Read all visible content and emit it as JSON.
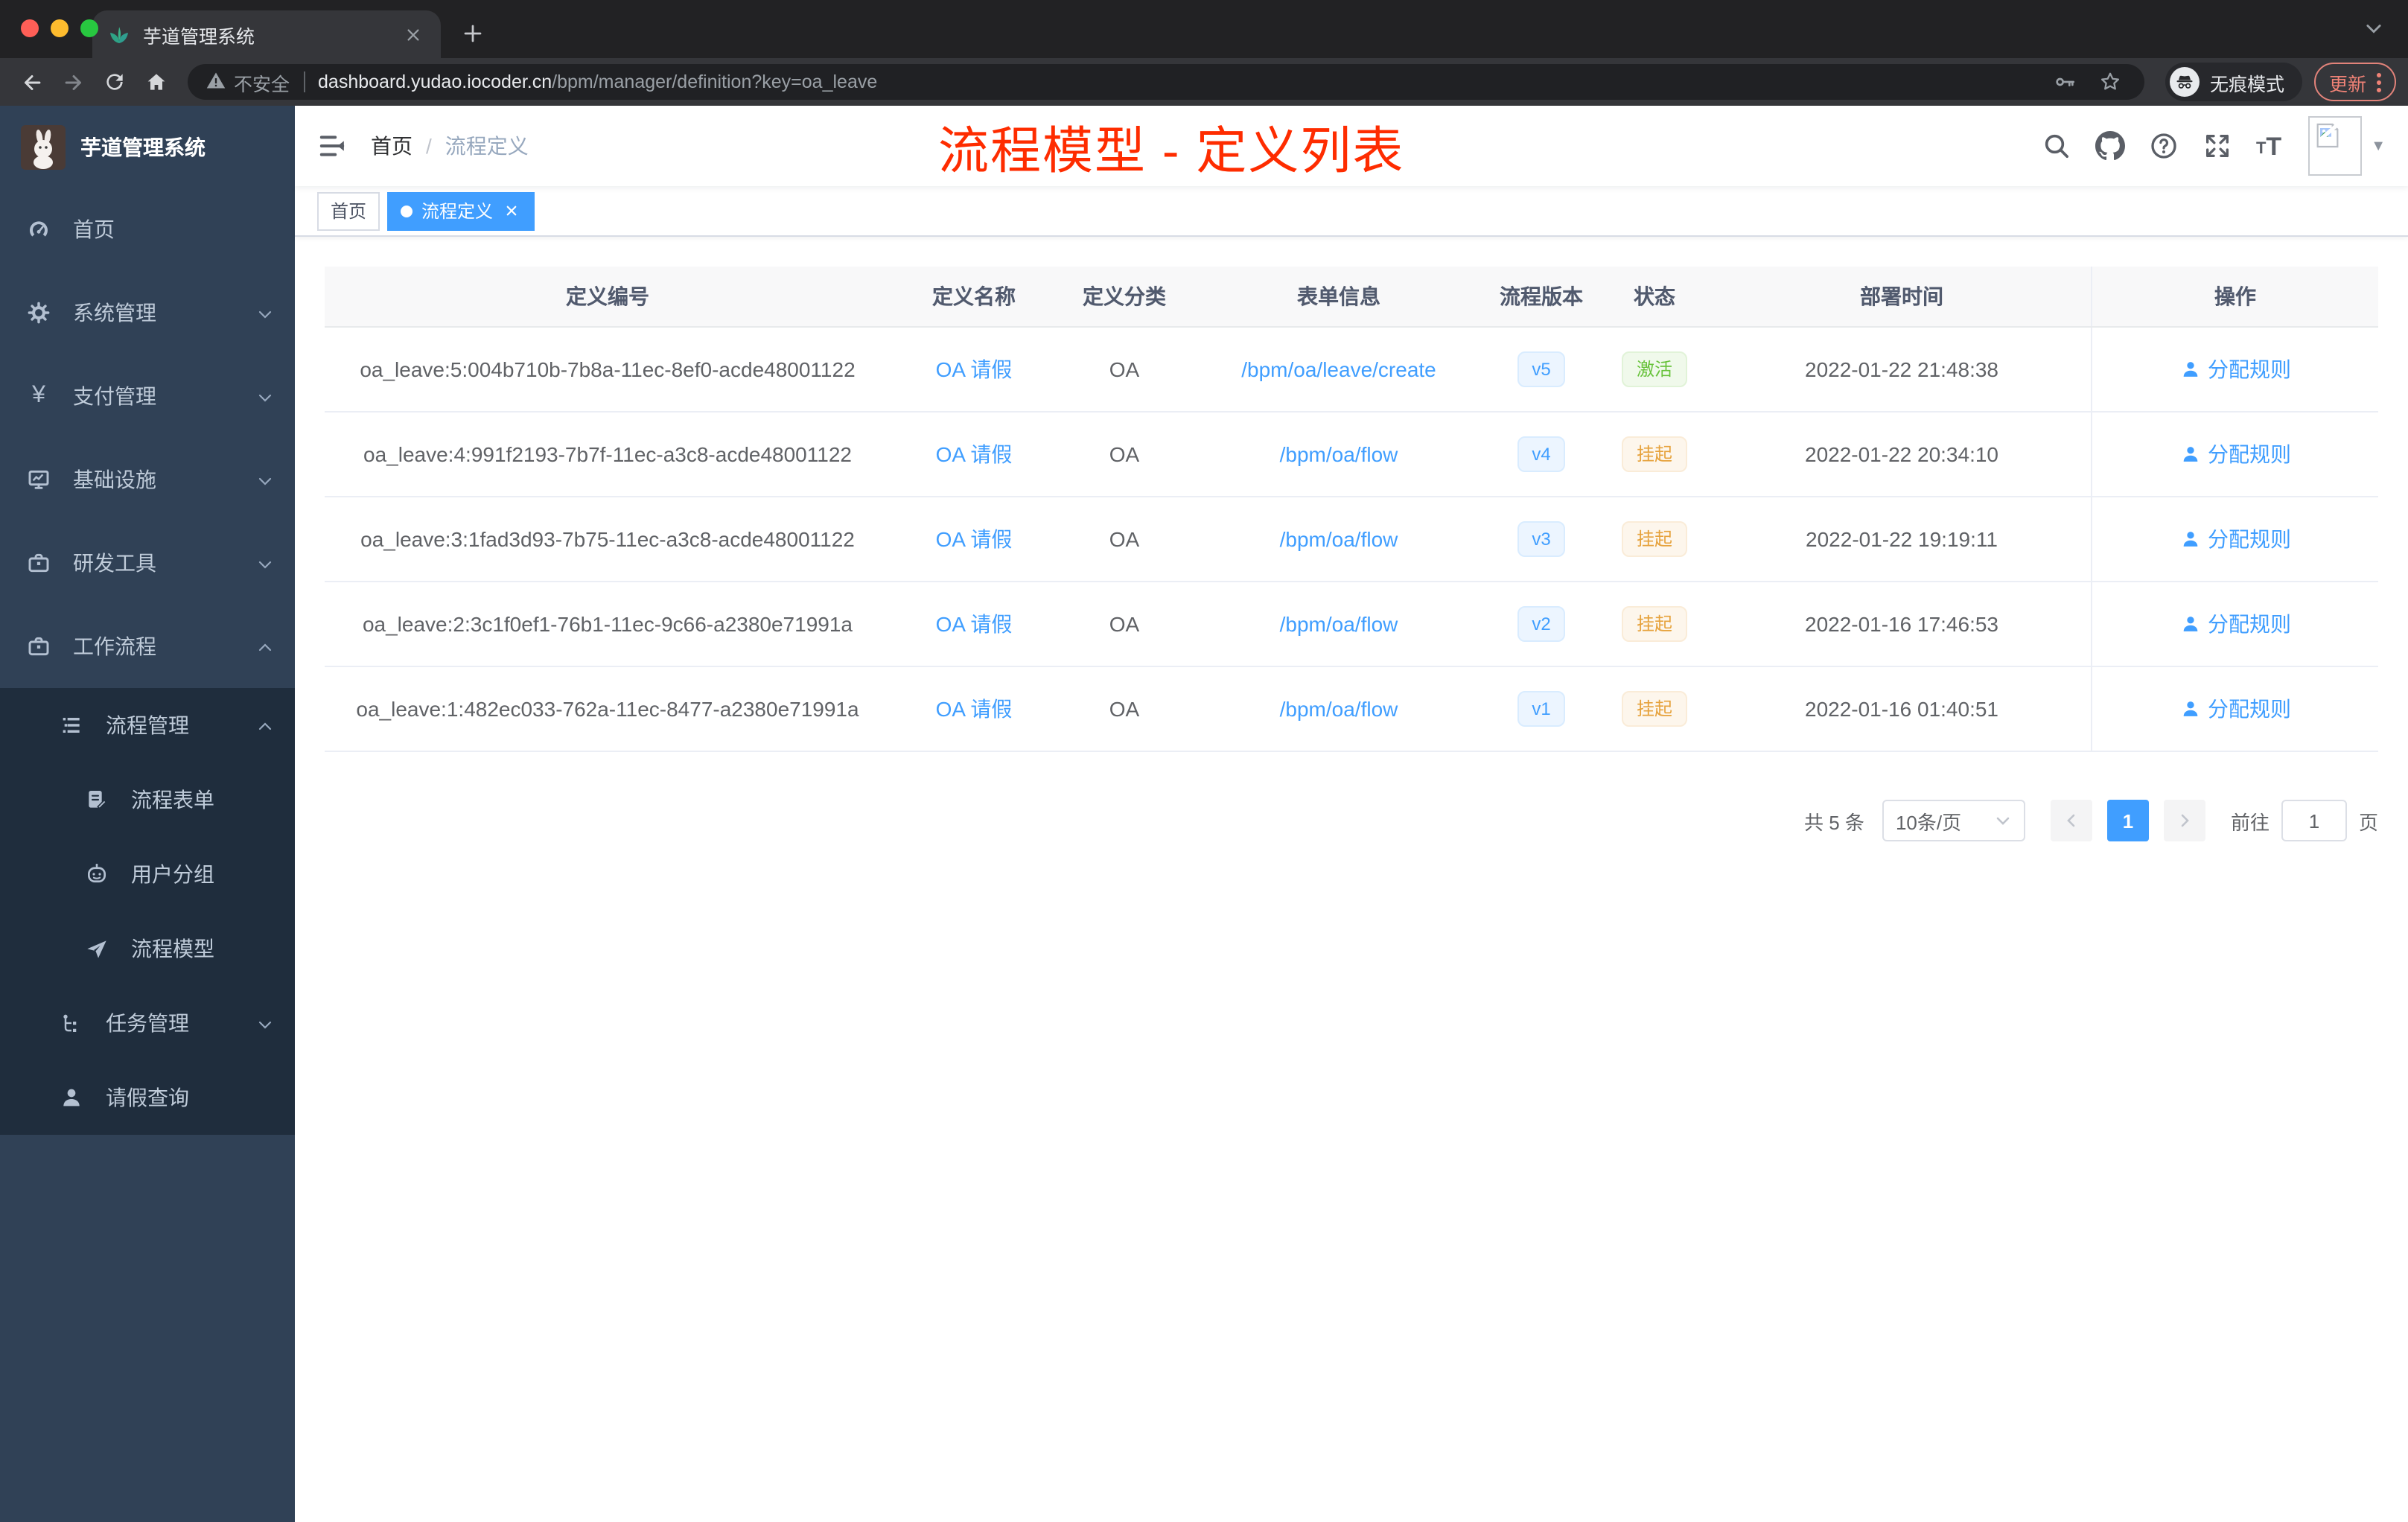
{
  "browser": {
    "tab_title": "芋道管理系统",
    "security_label": "不安全",
    "url_domain": "dashboard.yudao.iocoder.cn",
    "url_path": "/bpm/manager/definition?key=oa_leave",
    "incognito_label": "无痕模式",
    "update_label": "更新"
  },
  "sidebar": {
    "title": "芋道管理系统",
    "items": [
      {
        "label": "首页",
        "icon": "dashboard-icon"
      },
      {
        "label": "系统管理",
        "icon": "gear-icon",
        "arrow": "down"
      },
      {
        "label": "支付管理",
        "icon": "yen-icon",
        "arrow": "down"
      },
      {
        "label": "基础设施",
        "icon": "monitor-icon",
        "arrow": "down"
      },
      {
        "label": "研发工具",
        "icon": "toolbox-icon",
        "arrow": "down"
      },
      {
        "label": "工作流程",
        "icon": "briefcase-icon",
        "arrow": "up"
      },
      {
        "label": "流程管理",
        "icon": "list-icon",
        "arrow": "up"
      },
      {
        "label": "流程表单",
        "icon": "form-icon"
      },
      {
        "label": "用户分组",
        "icon": "robot-icon"
      },
      {
        "label": "流程模型",
        "icon": "send-icon"
      },
      {
        "label": "任务管理",
        "icon": "tree-icon",
        "arrow": "down"
      },
      {
        "label": "请假查询",
        "icon": "user-icon"
      }
    ],
    "yen_glyph": "¥"
  },
  "header": {
    "breadcrumb": [
      "首页",
      "流程定义"
    ],
    "separator": "/"
  },
  "tags": [
    {
      "label": "首页",
      "active": false
    },
    {
      "label": "流程定义",
      "active": true
    }
  ],
  "annotation": {
    "text": "流程模型 - 定义列表"
  },
  "table": {
    "columns": [
      "定义编号",
      "定义名称",
      "定义分类",
      "表单信息",
      "流程版本",
      "状态",
      "部署时间",
      "操作"
    ],
    "rows": [
      {
        "id": "oa_leave:5:004b710b-7b8a-11ec-8ef0-acde48001122",
        "name": "OA 请假",
        "category": "OA",
        "form": "/bpm/oa/leave/create",
        "version": "v5",
        "status": "激活",
        "status_type": "active",
        "time": "2022-01-22 21:48:38",
        "action": "分配规则"
      },
      {
        "id": "oa_leave:4:991f2193-7b7f-11ec-a3c8-acde48001122",
        "name": "OA 请假",
        "category": "OA",
        "form": "/bpm/oa/flow",
        "version": "v4",
        "status": "挂起",
        "status_type": "suspended",
        "time": "2022-01-22 20:34:10",
        "action": "分配规则"
      },
      {
        "id": "oa_leave:3:1fad3d93-7b75-11ec-a3c8-acde48001122",
        "name": "OA 请假",
        "category": "OA",
        "form": "/bpm/oa/flow",
        "version": "v3",
        "status": "挂起",
        "status_type": "suspended",
        "time": "2022-01-22 19:19:11",
        "action": "分配规则"
      },
      {
        "id": "oa_leave:2:3c1f0ef1-76b1-11ec-9c66-a2380e71991a",
        "name": "OA 请假",
        "category": "OA",
        "form": "/bpm/oa/flow",
        "version": "v2",
        "status": "挂起",
        "status_type": "suspended",
        "time": "2022-01-16 17:46:53",
        "action": "分配规则"
      },
      {
        "id": "oa_leave:1:482ec033-762a-11ec-8477-a2380e71991a",
        "name": "OA 请假",
        "category": "OA",
        "form": "/bpm/oa/flow",
        "version": "v1",
        "status": "挂起",
        "status_type": "suspended",
        "time": "2022-01-16 01:40:51",
        "action": "分配规则"
      }
    ]
  },
  "pagination": {
    "total_label": "共 5 条",
    "page_size": "10条/页",
    "current": "1",
    "goto_prefix": "前往",
    "goto_value": "1",
    "goto_suffix": "页"
  },
  "colors": {
    "accent": "#409eff",
    "success": "#67c23a",
    "warning": "#e6a23c",
    "annotation_red": "#fe2c00",
    "sidebar_bg": "#304156",
    "submenu_bg": "#1f2d3d"
  }
}
